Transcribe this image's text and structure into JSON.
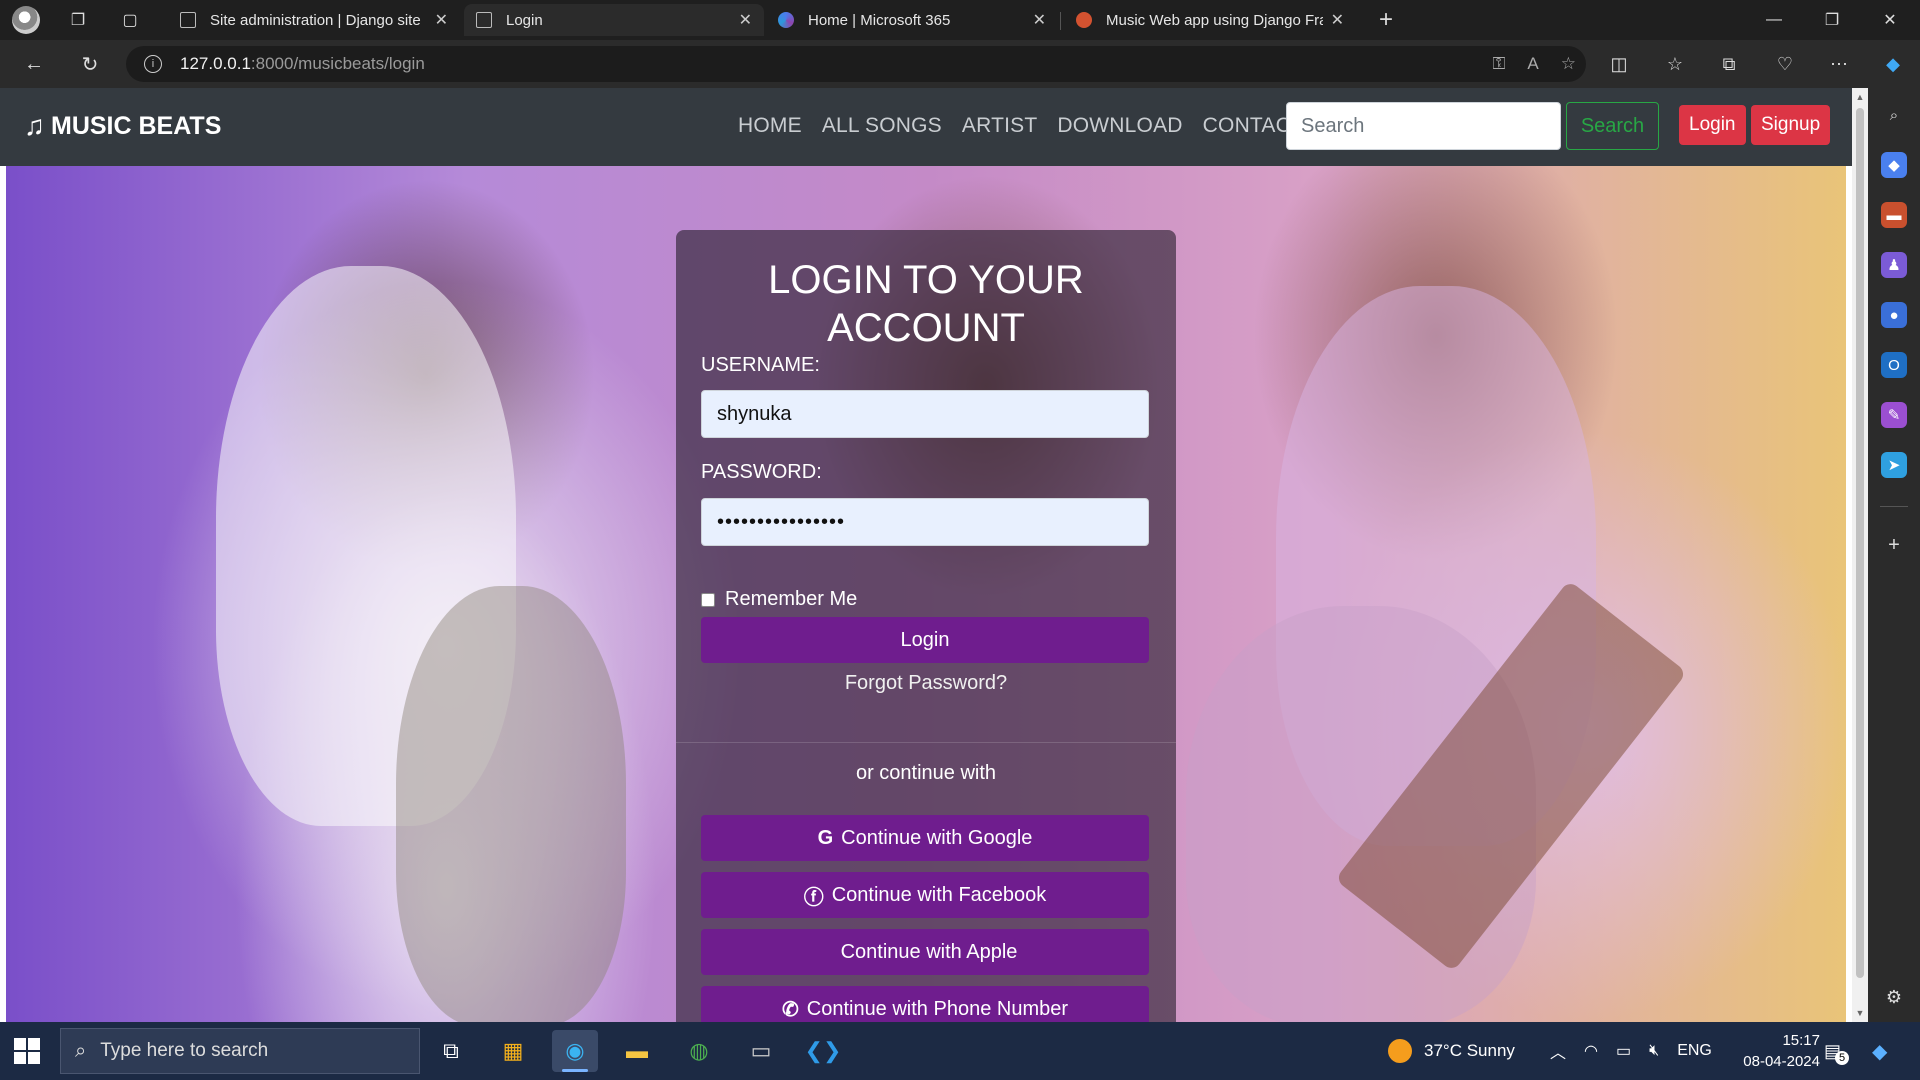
{
  "browser": {
    "tabs": [
      {
        "title": "Site administration | Django site",
        "icon": "document-icon"
      },
      {
        "title": "Login",
        "icon": "document-icon",
        "active": true
      },
      {
        "title": "Home | Microsoft 365",
        "icon": "microsoft365-icon"
      },
      {
        "title": "Music Web app using Django Fra",
        "icon": "powerpoint-icon"
      }
    ],
    "url_host": "127.0.0.1",
    "url_path": ":8000/musicbeats/login"
  },
  "site": {
    "brand": "MUSIC BEATS",
    "brand_icon": "music-note-icon",
    "menu": [
      "HOME",
      "ALL SONGS",
      "ARTIST",
      "DOWNLOAD",
      "CONTACT"
    ],
    "search_placeholder": "Search",
    "search_button": "Search",
    "login_button": "Login",
    "signup_button": "Signup",
    "colors": {
      "navbar": "#343a40",
      "accent_purple": "#6f1d8e",
      "danger": "#dc3545",
      "success": "#28a745"
    }
  },
  "login_form": {
    "title": "LOGIN TO YOUR ACCOUNT",
    "username_label": "USERNAME:",
    "username_value": "shynuka",
    "password_label": "PASSWORD:",
    "password_value": "••••••••••••••••",
    "remember_label": "Remember Me",
    "submit_label": "Login",
    "forgot_label": "Forgot Password?",
    "or_text": "or continue with",
    "social": [
      {
        "label": "Continue with Google",
        "icon": "google-icon"
      },
      {
        "label": "Continue with Facebook",
        "icon": "facebook-icon"
      },
      {
        "label": "Continue with Apple",
        "icon": "apple-icon"
      },
      {
        "label": "Continue with Phone Number",
        "icon": "phone-icon"
      }
    ]
  },
  "taskbar": {
    "search_placeholder": "Type here to search",
    "weather": "37°C  Sunny",
    "language": "ENG",
    "time": "15:17",
    "date": "08-04-2024",
    "notification_count": "5"
  }
}
